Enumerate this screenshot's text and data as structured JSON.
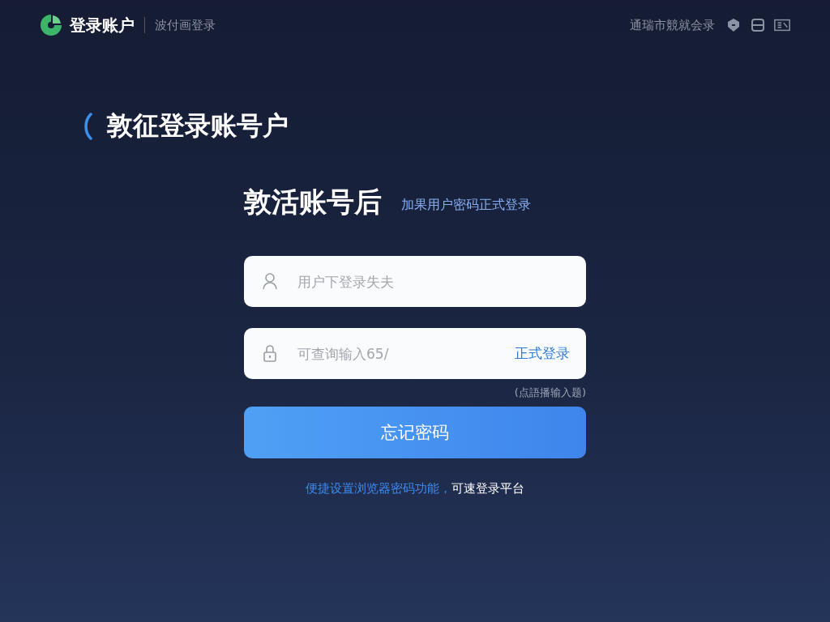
{
  "header": {
    "title": "登录账户",
    "subtitle": "波付画登录",
    "right_text": "通瑞市競就会录"
  },
  "page": {
    "back_title": "敦征登录账号户",
    "heading": "敦活账号后",
    "heading_link": "加果用户密码正式登录"
  },
  "form": {
    "username": {
      "placeholder": "用户下登录失夫"
    },
    "password": {
      "placeholder": "可查询输入65/",
      "action": "正式登录"
    },
    "hint": "(点語播输入题)",
    "submit": "忘记密码"
  },
  "footer": {
    "link": "便捷设置浏览器密码功能，",
    "text": "可速登录平台"
  }
}
